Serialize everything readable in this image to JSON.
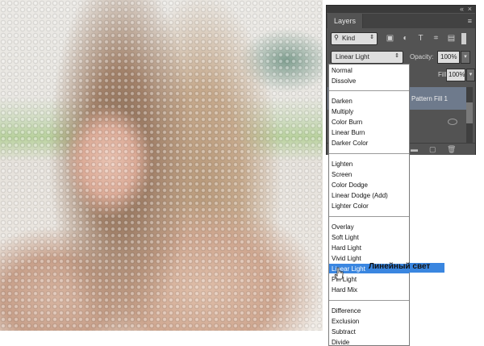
{
  "panel": {
    "tab_label": "Layers",
    "collapse_icon": "«",
    "close_icon": "×",
    "menu_icon": "≡",
    "kind_label": "Kind",
    "filter_icons": [
      "image-filter-icon",
      "adjustment-filter-icon",
      "type-filter-icon",
      "shape-filter-icon",
      "smart-object-filter-icon"
    ],
    "blend_mode": "Linear Light",
    "opacity_label": "Opacity:",
    "opacity_value": "100%",
    "fill_label": "Fill:",
    "fill_value": "100%",
    "layer_name": "Pattern Fill 1"
  },
  "blend_modes": {
    "group1": [
      "Normal",
      "Dissolve"
    ],
    "group2": [
      "Darken",
      "Multiply",
      "Color Burn",
      "Linear Burn",
      "Darker Color"
    ],
    "group3": [
      "Lighten",
      "Screen",
      "Color Dodge",
      "Linear Dodge (Add)",
      "Lighter Color"
    ],
    "group4": [
      "Overlay",
      "Soft Light",
      "Hard Light",
      "Vivid Light",
      "Linear Light",
      "Pin Light",
      "Hard Mix"
    ],
    "group5": [
      "Difference",
      "Exclusion",
      "Subtract",
      "Divide"
    ]
  },
  "selected_mode": "Linear Light",
  "translation_label": "Линейный свет",
  "colors": {
    "panel_bg": "#535353",
    "highlight": "#3a86e0",
    "layer_selected": "#6e7a8c"
  }
}
